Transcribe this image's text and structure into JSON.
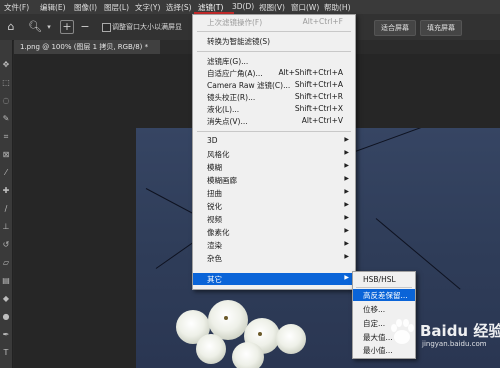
{
  "menubar": {
    "items": [
      {
        "label": "文件(F)"
      },
      {
        "label": "编辑(E)"
      },
      {
        "label": "图像(I)"
      },
      {
        "label": "图层(L)"
      },
      {
        "label": "文字(Y)"
      },
      {
        "label": "选择(S)"
      },
      {
        "label": "滤镜(T)"
      },
      {
        "label": "3D(D)"
      },
      {
        "label": "视图(V)"
      },
      {
        "label": "窗口(W)"
      },
      {
        "label": "帮助(H)"
      }
    ]
  },
  "options": {
    "checkbox_label": "调整窗口大小以满屏显",
    "fit_screen_label": "适合屏幕",
    "fill_screen_label": "填充屏幕"
  },
  "document_tab": {
    "label": "1.png @ 100% (图层 1 拷贝, RGB/8) *"
  },
  "filter_menu": {
    "items": [
      {
        "label": "上次滤镜操作(F)",
        "shortcut": "Alt+Ctrl+F"
      },
      {
        "label": "转换为智能滤镜(S)",
        "shortcut": ""
      },
      {
        "label": "滤镜库(G)...",
        "shortcut": ""
      },
      {
        "label": "自适应广角(A)...",
        "shortcut": "Alt+Shift+Ctrl+A"
      },
      {
        "label": "Camera Raw 滤镜(C)...",
        "shortcut": "Shift+Ctrl+A"
      },
      {
        "label": "镜头校正(R)...",
        "shortcut": "Shift+Ctrl+R"
      },
      {
        "label": "液化(L)...",
        "shortcut": "Shift+Ctrl+X"
      },
      {
        "label": "消失点(V)...",
        "shortcut": "Alt+Ctrl+V"
      },
      {
        "label": "3D"
      },
      {
        "label": "风格化"
      },
      {
        "label": "模糊"
      },
      {
        "label": "模糊画廊"
      },
      {
        "label": "扭曲"
      },
      {
        "label": "锐化"
      },
      {
        "label": "视频"
      },
      {
        "label": "像素化"
      },
      {
        "label": "渲染"
      },
      {
        "label": "杂色"
      },
      {
        "label": "其它"
      }
    ]
  },
  "other_submenu": {
    "items": [
      {
        "label": "HSB/HSL"
      },
      {
        "label": "高反差保留..."
      },
      {
        "label": "位移..."
      },
      {
        "label": "自定..."
      },
      {
        "label": "最大值..."
      },
      {
        "label": "最小值..."
      }
    ]
  },
  "watermark": {
    "brand": "Baidu 经验",
    "url": "jingyan.baidu.com"
  },
  "colors": {
    "highlight": "#0a64d8",
    "menu_bg": "#f0f0f0",
    "chrome": "#3a3a3a"
  }
}
